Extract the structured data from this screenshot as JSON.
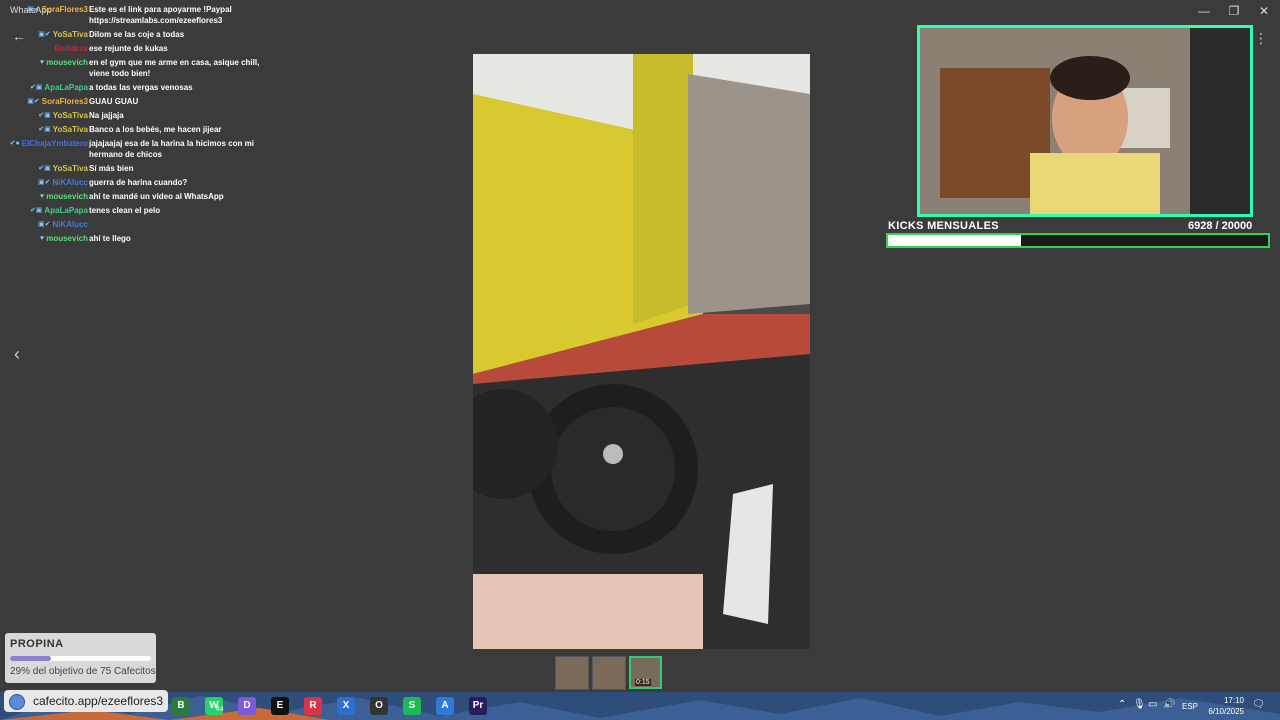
{
  "window": {
    "title": "WhatsApp",
    "minimize": "—",
    "maximize": "❐",
    "close": "✕",
    "back": "←",
    "more": "⋮",
    "nav_prev": "‹"
  },
  "chat": [
    {
      "user": "SoraFlores3",
      "color": "#f0b24b",
      "badges": "▣✔",
      "text": "Este es el link para apoyarme !Paypal https://streamlabs.com/ezeeflores3"
    },
    {
      "user": "YoSaTiva",
      "color": "#d9c64a",
      "badges": "▣✔",
      "text": "Dilom se las coje a todas"
    },
    {
      "user": "Bellidrxx",
      "color": "#c8233b",
      "badges": "",
      "text": "ese rejunte de kukas"
    },
    {
      "user": "mousevich",
      "color": "#53e07a",
      "badges": "♥",
      "text": "en el gym que me arme en casa, asique chill, viene todo bien!"
    },
    {
      "user": "ApaLaPapa",
      "color": "#3fcf8e",
      "badges": "✔▣",
      "text": "a todas las vergas venosas"
    },
    {
      "user": "SoraFlores3",
      "color": "#f0b24b",
      "badges": "▣✔",
      "text": "GUAU GUAU"
    },
    {
      "user": "YoSaTiva",
      "color": "#d9c64a",
      "badges": "✔▣",
      "text": "Na jajjaja"
    },
    {
      "user": "YoSaTiva",
      "color": "#d9c64a",
      "badges": "✔▣",
      "text": "Banco a los bebés, me hacen jijear"
    },
    {
      "user": "ElChajaYmbatero",
      "color": "#4b6fe0",
      "badges": "✔●",
      "text": "jajajaajaj esa de la harina la hicimos con mi hermano de chicos"
    },
    {
      "user": "YoSaTiva",
      "color": "#d9c64a",
      "badges": "✔▣",
      "text": "Sí más bien"
    },
    {
      "user": "NiKAlucc",
      "color": "#3b7de0",
      "badges": "▣✔",
      "text": "guerra de harina cuando?"
    },
    {
      "user": "mousevich",
      "color": "#53e07a",
      "badges": "♥",
      "text": "ahí te mandé un video al WhatsApp"
    },
    {
      "user": "ApaLaPapa",
      "color": "#3fcf8e",
      "badges": "✔▣",
      "text": "tenes clean el pelo"
    },
    {
      "user": "NiKAlucc",
      "color": "#3b7de0",
      "badges": "▣✔",
      "text": ""
    },
    {
      "user": "mousevich",
      "color": "#53e07a",
      "badges": "♥",
      "text": "ahí te llego"
    }
  ],
  "kicks": {
    "title": "KICKS MENSUALES",
    "current": "6928",
    "goal": " / 20000",
    "progress": 0.35
  },
  "propina": {
    "title": "PROPINA",
    "progress": 0.29,
    "text": "29% del objetivo de 75 Cafecitos"
  },
  "thumbnails": {
    "duration": "0:15"
  },
  "taskbar": {
    "pill_text": "cafecito.app/ezeeflores3",
    "apps": [
      {
        "name": "B",
        "color": "#2a7a3a"
      },
      {
        "name": "W",
        "color": "#25d366"
      },
      {
        "name": "D",
        "color": "#7b5bd6"
      },
      {
        "name": "E",
        "color": "#111111"
      },
      {
        "name": "R",
        "color": "#d9344a"
      },
      {
        "name": "X",
        "color": "#2f6fcf"
      },
      {
        "name": "O",
        "color": "#333333"
      },
      {
        "name": "S",
        "color": "#1db954"
      },
      {
        "name": "A",
        "color": "#2e7bd6"
      },
      {
        "name": "Pr",
        "color": "#2a1a5e"
      }
    ],
    "whatsapp_badge": "44",
    "lang": "ESP",
    "time": "17:10",
    "date": "6/10/2025"
  }
}
